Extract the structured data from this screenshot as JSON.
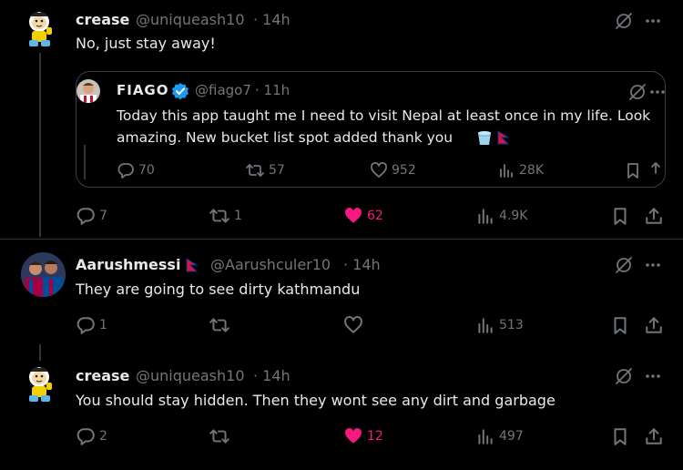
{
  "tweets": [
    {
      "name": "crease",
      "handle": "@uniqueash10",
      "time": "· 14h",
      "text": "No, just stay away!",
      "replies": "7",
      "retweets": "1",
      "likes": "62",
      "views": "4.9K"
    },
    {
      "name": "Aarushmessi",
      "handle": "@Aarushculer10",
      "time": "· 14h",
      "text": "They are going to see dirty kathmandu",
      "replies": "1",
      "retweets": "",
      "likes": "",
      "views": "513"
    },
    {
      "name": "crease",
      "handle": "@uniqueash10",
      "time": "· 14h",
      "text": "You should stay hidden. Then they wont see any dirt and garbage",
      "replies": "2",
      "retweets": "",
      "likes": "12",
      "views": "497"
    }
  ],
  "quote": {
    "name": "FIAGO",
    "handle": "@fiago7",
    "time": "· 11h",
    "line1": "Today this app taught me I need to visit Nepal at least once in my life. Look",
    "line2": "amazing. New bucket list spot added thank you",
    "replies": "70",
    "retweets": "57",
    "likes": "952",
    "views": "28K"
  },
  "colors": {
    "background": "#000000",
    "text": "#e7e9ea",
    "muted": "#71767b",
    "like": "#f91880",
    "verified": "#1d9bf0",
    "nepal_flag": "#dc143c"
  },
  "icons": [
    "more-icon",
    "grok-icon",
    "reply-icon",
    "retweet-icon",
    "like-icon",
    "views-icon",
    "bookmark-icon",
    "share-icon",
    "verified-icon",
    "bucket-emoji",
    "nepal-flag"
  ]
}
